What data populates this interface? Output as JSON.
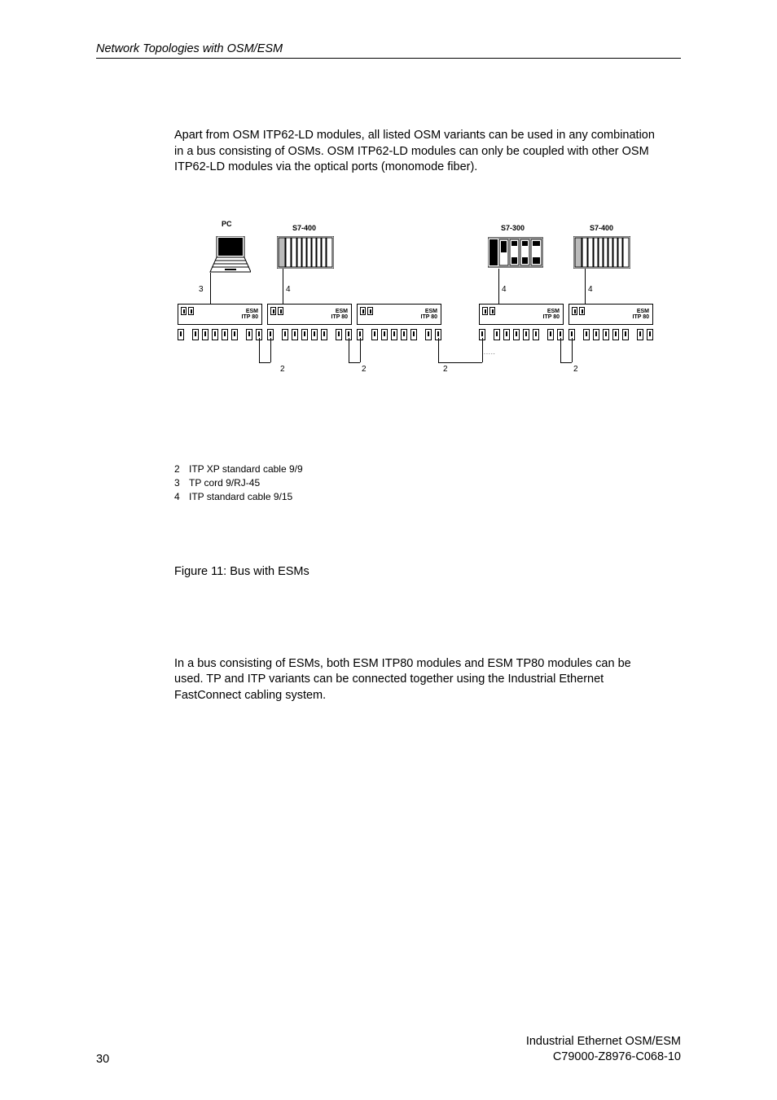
{
  "header": {
    "title": "Network Topologies with OSM/ESM"
  },
  "paragraph1": "Apart from OSM ITP62-LD modules, all listed OSM variants can be used in any combination in a bus consisting of OSMs. OSM ITP62-LD modules can only be coupled with other OSM ITP62-LD modules via the optical ports (monomode fiber).",
  "diagram": {
    "labels": {
      "pc": "PC",
      "s7400": "S7-400",
      "s7300": "S7-300"
    },
    "vert_label_3": "3",
    "vert_label_4": "4",
    "esm_label_line1": "ESM",
    "esm_label_line2": "ITP 80",
    "cable_label_2": "2"
  },
  "legend": [
    {
      "num": "2",
      "text": "ITP XP standard cable 9/9"
    },
    {
      "num": "3",
      "text": "TP cord 9/RJ-45"
    },
    {
      "num": "4",
      "text": "ITP standard cable 9/15"
    }
  ],
  "figure_caption": "Figure 11: Bus with ESMs",
  "paragraph2": "In a bus consisting of ESMs, both ESM ITP80 modules and ESM TP80 modules can be used. TP and ITP variants can be connected together using the Industrial Ethernet FastConnect cabling system.",
  "footer": {
    "page_number": "30",
    "right_line1": "Industrial Ethernet OSM/ESM",
    "right_line2": "C79000-Z8976-C068-10"
  }
}
